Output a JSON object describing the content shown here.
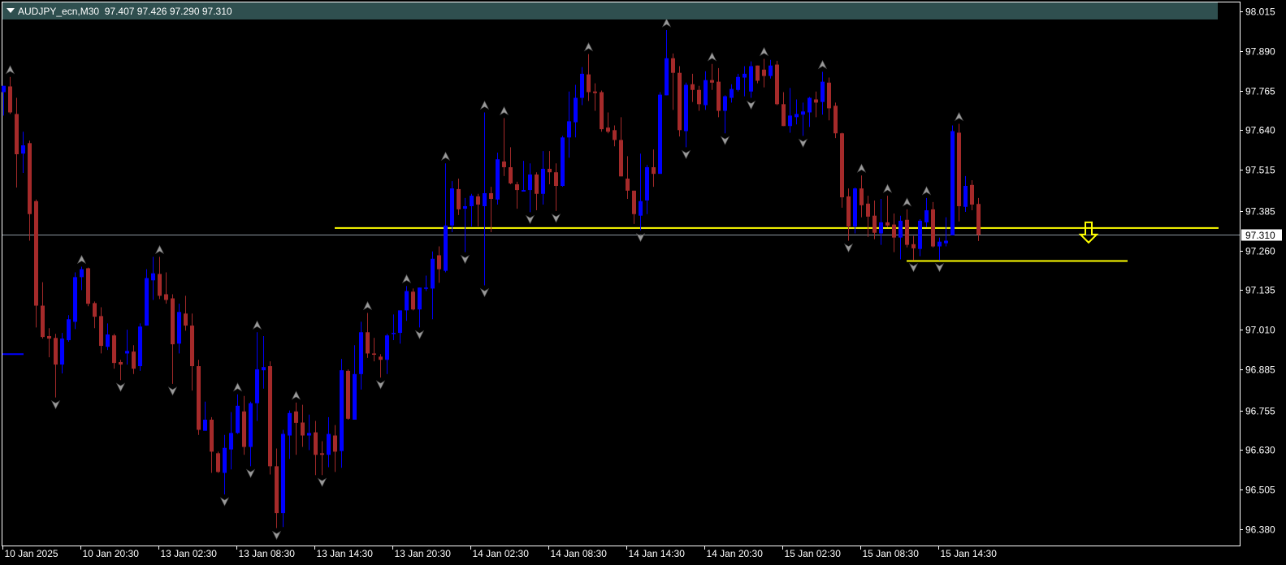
{
  "header": {
    "symbol": "AUDJPY_ecn,M30",
    "open": "97.407",
    "high": "97.426",
    "low": "97.290",
    "close": "97.310"
  },
  "colors": {
    "background": "#000000",
    "bull": "#0000ff",
    "bear": "#a52a2a",
    "header_bg": "#2f4f4f",
    "level_lines": "#ffff00",
    "price_line": "#8c96a0",
    "fractal": "#9a9a9a"
  },
  "chart_data": {
    "type": "candlestick",
    "symbol": "AUDJPY_ecn",
    "timeframe": "M30",
    "ylim": [
      96.38,
      98.015
    ],
    "y_ticks": [
      "98.015",
      "97.890",
      "97.765",
      "97.640",
      "97.515",
      "97.385",
      "97.260",
      "97.135",
      "97.010",
      "96.885",
      "96.755",
      "96.630",
      "96.505",
      "96.380"
    ],
    "current_price": "97.310",
    "x_ticks": [
      {
        "bar": 0,
        "label": "10 Jan 2025"
      },
      {
        "bar": 12,
        "label": "10 Jan 20:30"
      },
      {
        "bar": 24,
        "label": "13 Jan 02:30"
      },
      {
        "bar": 36,
        "label": "13 Jan 08:30"
      },
      {
        "bar": 48,
        "label": "13 Jan 14:30"
      },
      {
        "bar": 60,
        "label": "13 Jan 20:30"
      },
      {
        "bar": 72,
        "label": "14 Jan 02:30"
      },
      {
        "bar": 84,
        "label": "14 Jan 08:30"
      },
      {
        "bar": 96,
        "label": "14 Jan 14:30"
      },
      {
        "bar": 108,
        "label": "14 Jan 20:30"
      },
      {
        "bar": 120,
        "label": "15 Jan 02:30"
      },
      {
        "bar": 132,
        "label": "15 Jan 08:30"
      },
      {
        "bar": 144,
        "label": "15 Jan 14:30"
      }
    ],
    "ohlc": [
      [
        97.76,
        97.78,
        97.686,
        97.78
      ],
      [
        97.778,
        97.808,
        97.691,
        97.696
      ],
      [
        97.691,
        97.742,
        97.459,
        97.564
      ],
      [
        97.566,
        97.635,
        97.505,
        97.592
      ],
      [
        97.599,
        97.607,
        97.291,
        97.375
      ],
      [
        97.416,
        97.421,
        97.017,
        97.086
      ],
      [
        97.086,
        97.16,
        96.982,
        96.987
      ],
      [
        96.99,
        97.015,
        96.923,
        96.982
      ],
      [
        96.984,
        96.997,
        96.796,
        96.9
      ],
      [
        96.9,
        97.0,
        96.872,
        96.982
      ],
      [
        96.977,
        97.056,
        96.972,
        97.043
      ],
      [
        97.035,
        97.191,
        97.012,
        97.176
      ],
      [
        97.176,
        97.209,
        97.135,
        97.201
      ],
      [
        97.204,
        97.206,
        97.084,
        97.092
      ],
      [
        97.094,
        97.099,
        97.015,
        97.051
      ],
      [
        97.053,
        97.081,
        96.935,
        96.959
      ],
      [
        96.956,
        97.03,
        96.946,
        96.995
      ],
      [
        96.992,
        96.997,
        96.887,
        96.905
      ],
      [
        96.908,
        96.915,
        96.851,
        96.9
      ],
      [
        96.935,
        97.01,
        96.9,
        96.943
      ],
      [
        96.941,
        96.961,
        96.87,
        96.887
      ],
      [
        96.895,
        97.03,
        96.88,
        97.02
      ],
      [
        97.023,
        97.201,
        97.023,
        97.173
      ],
      [
        97.166,
        97.24,
        97.104,
        97.188
      ],
      [
        97.186,
        97.24,
        97.107,
        97.117
      ],
      [
        97.122,
        97.191,
        97.092,
        97.104
      ],
      [
        97.109,
        97.122,
        96.839,
        96.964
      ],
      [
        96.966,
        97.092,
        96.935,
        97.066
      ],
      [
        97.061,
        97.117,
        97.007,
        97.023
      ],
      [
        97.023,
        97.061,
        96.818,
        96.895
      ],
      [
        96.895,
        96.915,
        96.678,
        96.694
      ],
      [
        96.691,
        96.783,
        96.691,
        96.726
      ],
      [
        96.726,
        96.734,
        96.558,
        96.625
      ],
      [
        96.62,
        96.625,
        96.558,
        96.561
      ],
      [
        96.558,
        96.678,
        96.49,
        96.637
      ],
      [
        96.632,
        96.75,
        96.569,
        96.684
      ],
      [
        96.684,
        96.806,
        96.681,
        96.77
      ],
      [
        96.752,
        96.801,
        96.615,
        96.64
      ],
      [
        96.64,
        96.783,
        96.579,
        96.778
      ],
      [
        96.778,
        97.002,
        96.722,
        96.885
      ],
      [
        96.882,
        96.99,
        96.824,
        96.892
      ],
      [
        96.895,
        96.91,
        96.553,
        96.579
      ],
      [
        96.579,
        96.635,
        96.384,
        96.431
      ],
      [
        96.431,
        96.694,
        96.387,
        96.681
      ],
      [
        96.676,
        96.755,
        96.602,
        96.747
      ],
      [
        96.752,
        96.78,
        96.615,
        96.716
      ],
      [
        96.717,
        96.773,
        96.64,
        96.676
      ],
      [
        96.676,
        96.742,
        96.63,
        96.684
      ],
      [
        96.686,
        96.722,
        96.551,
        96.615
      ],
      [
        96.62,
        96.658,
        96.551,
        96.615
      ],
      [
        96.615,
        96.734,
        96.576,
        96.681
      ],
      [
        96.676,
        96.709,
        96.561,
        96.625
      ],
      [
        96.627,
        96.918,
        96.574,
        96.882
      ],
      [
        96.88,
        96.885,
        96.726,
        96.729
      ],
      [
        96.726,
        96.961,
        96.726,
        96.87
      ],
      [
        96.87,
        97.035,
        96.821,
        97.002
      ],
      [
        97.002,
        97.063,
        96.921,
        96.935
      ],
      [
        96.935,
        96.984,
        96.91,
        96.931
      ],
      [
        96.925,
        96.933,
        96.859,
        96.915
      ],
      [
        96.915,
        96.997,
        96.87,
        96.992
      ],
      [
        96.997,
        97.058,
        96.977,
        97.0
      ],
      [
        97.0,
        97.071,
        96.966,
        97.071
      ],
      [
        97.071,
        97.148,
        97.038,
        97.132
      ],
      [
        97.13,
        97.14,
        97.071,
        97.074
      ],
      [
        97.074,
        97.143,
        97.017,
        97.143
      ],
      [
        97.14,
        97.181,
        97.132,
        97.143
      ],
      [
        97.14,
        97.257,
        97.043,
        97.234
      ],
      [
        97.245,
        97.273,
        97.158,
        97.201
      ],
      [
        97.196,
        97.535,
        97.191,
        97.339
      ],
      [
        97.339,
        97.479,
        97.318,
        97.456
      ],
      [
        97.454,
        97.487,
        97.372,
        97.39
      ],
      [
        97.392,
        97.426,
        97.255,
        97.4
      ],
      [
        97.4,
        97.439,
        97.336,
        97.433
      ],
      [
        97.431,
        97.439,
        97.336,
        97.405
      ],
      [
        97.4,
        97.696,
        97.15,
        97.441
      ],
      [
        97.441,
        97.461,
        97.318,
        97.423
      ],
      [
        97.421,
        97.569,
        97.405,
        97.548
      ],
      [
        97.541,
        97.678,
        97.495,
        97.523
      ],
      [
        97.523,
        97.586,
        97.469,
        97.472
      ],
      [
        97.469,
        97.477,
        97.392,
        97.451
      ],
      [
        97.446,
        97.543,
        97.446,
        97.451
      ],
      [
        97.451,
        97.535,
        97.381,
        97.5
      ],
      [
        97.5,
        97.507,
        97.387,
        97.439
      ],
      [
        97.439,
        97.574,
        97.405,
        97.518
      ],
      [
        97.518,
        97.574,
        97.469,
        97.507
      ],
      [
        97.507,
        97.535,
        97.385,
        97.464
      ],
      [
        97.464,
        97.622,
        97.461,
        97.617
      ],
      [
        97.617,
        97.762,
        97.553,
        97.668
      ],
      [
        97.665,
        97.783,
        97.617,
        97.742
      ],
      [
        97.742,
        97.839,
        97.719,
        97.818
      ],
      [
        97.816,
        97.88,
        97.732,
        97.76
      ],
      [
        97.762,
        97.788,
        97.701,
        97.757
      ],
      [
        97.76,
        97.765,
        97.635,
        97.643
      ],
      [
        97.648,
        97.696,
        97.63,
        97.635
      ],
      [
        97.64,
        97.655,
        97.589,
        97.609
      ],
      [
        97.609,
        97.681,
        97.494,
        97.494
      ],
      [
        97.487,
        97.558,
        97.423,
        97.449
      ],
      [
        97.449,
        97.449,
        97.344,
        97.375
      ],
      [
        97.37,
        97.566,
        97.324,
        97.416
      ],
      [
        97.418,
        97.53,
        97.375,
        97.523
      ],
      [
        97.523,
        97.579,
        97.461,
        97.502
      ],
      [
        97.502,
        97.76,
        97.502,
        97.752
      ],
      [
        97.75,
        97.956,
        97.75,
        97.867
      ],
      [
        97.867,
        97.882,
        97.704,
        97.821
      ],
      [
        97.821,
        97.842,
        97.62,
        97.64
      ],
      [
        97.637,
        97.79,
        97.586,
        97.783
      ],
      [
        97.785,
        97.818,
        97.729,
        97.767
      ],
      [
        97.767,
        97.78,
        97.701,
        97.722
      ],
      [
        97.719,
        97.826,
        97.704,
        97.798
      ],
      [
        97.798,
        97.849,
        97.767,
        97.79
      ],
      [
        97.793,
        97.836,
        97.681,
        97.701
      ],
      [
        97.701,
        97.75,
        97.63,
        97.747
      ],
      [
        97.742,
        97.785,
        97.727,
        97.77
      ],
      [
        97.767,
        97.818,
        97.762,
        97.808
      ],
      [
        97.806,
        97.842,
        97.747,
        97.818
      ],
      [
        97.762,
        97.857,
        97.742,
        97.842
      ],
      [
        97.844,
        97.844,
        97.788,
        97.796
      ],
      [
        97.831,
        97.865,
        97.775,
        97.811
      ],
      [
        97.811,
        97.862,
        97.803,
        97.844
      ],
      [
        97.847,
        97.859,
        97.719,
        97.722
      ],
      [
        97.722,
        97.76,
        97.653,
        97.653
      ],
      [
        97.653,
        97.773,
        97.632,
        97.686
      ],
      [
        97.681,
        97.737,
        97.658,
        97.691
      ],
      [
        97.689,
        97.727,
        97.622,
        97.699
      ],
      [
        97.696,
        97.745,
        97.65,
        97.742
      ],
      [
        97.737,
        97.762,
        97.681,
        97.727
      ],
      [
        97.729,
        97.824,
        97.689,
        97.793
      ],
      [
        97.79,
        97.806,
        97.671,
        97.709
      ],
      [
        97.717,
        97.727,
        97.615,
        97.63
      ],
      [
        97.63,
        97.632,
        97.395,
        97.428
      ],
      [
        97.431,
        97.456,
        97.291,
        97.336
      ],
      [
        97.336,
        97.459,
        97.314,
        97.456
      ],
      [
        97.456,
        97.497,
        97.365,
        97.403
      ],
      [
        97.408,
        97.433,
        97.303,
        97.367
      ],
      [
        97.37,
        97.418,
        97.296,
        97.316
      ],
      [
        97.314,
        97.423,
        97.278,
        97.349
      ],
      [
        97.349,
        97.433,
        97.334,
        97.339
      ],
      [
        97.342,
        97.377,
        97.255,
        97.301
      ],
      [
        97.301,
        97.37,
        97.232,
        97.354
      ],
      [
        97.357,
        97.39,
        97.27,
        97.278
      ],
      [
        97.28,
        97.306,
        97.229,
        97.267
      ],
      [
        97.265,
        97.359,
        97.242,
        97.354
      ],
      [
        97.349,
        97.426,
        97.334,
        97.387
      ],
      [
        97.39,
        97.413,
        97.27,
        97.273
      ],
      [
        97.273,
        97.301,
        97.229,
        97.288
      ],
      [
        97.283,
        97.365,
        97.273,
        97.291
      ],
      [
        97.308,
        97.655,
        97.308,
        97.637
      ],
      [
        97.632,
        97.66,
        97.352,
        97.4
      ],
      [
        97.398,
        97.495,
        97.382,
        97.464
      ],
      [
        97.467,
        97.482,
        97.387,
        97.405
      ],
      [
        97.407,
        97.426,
        97.29,
        97.31
      ]
    ],
    "fractals_up": [
      1,
      12,
      24,
      36,
      39,
      45,
      56,
      62,
      68,
      74,
      77,
      90,
      102,
      109,
      117,
      126,
      132,
      136,
      139,
      142,
      147
    ],
    "fractals_down": [
      8,
      18,
      26,
      34,
      38,
      42,
      49,
      58,
      64,
      71,
      74,
      81,
      85,
      98,
      105,
      111,
      115,
      123,
      130,
      140,
      144
    ],
    "horizontal_lines": [
      {
        "price": 97.331,
        "from_bar": 51,
        "to_bar": 187,
        "color": "#ffff00"
      },
      {
        "price": 97.227,
        "from_bar": 139,
        "to_bar": 173,
        "color": "#ffff00"
      }
    ],
    "left_level": {
      "price": 96.933,
      "from_bar": 0,
      "to_bar": 3,
      "color": "#0000ff"
    },
    "sell_arrow": {
      "bar": 167,
      "price": 97.285,
      "direction": "down",
      "color": "#ffff00"
    }
  }
}
